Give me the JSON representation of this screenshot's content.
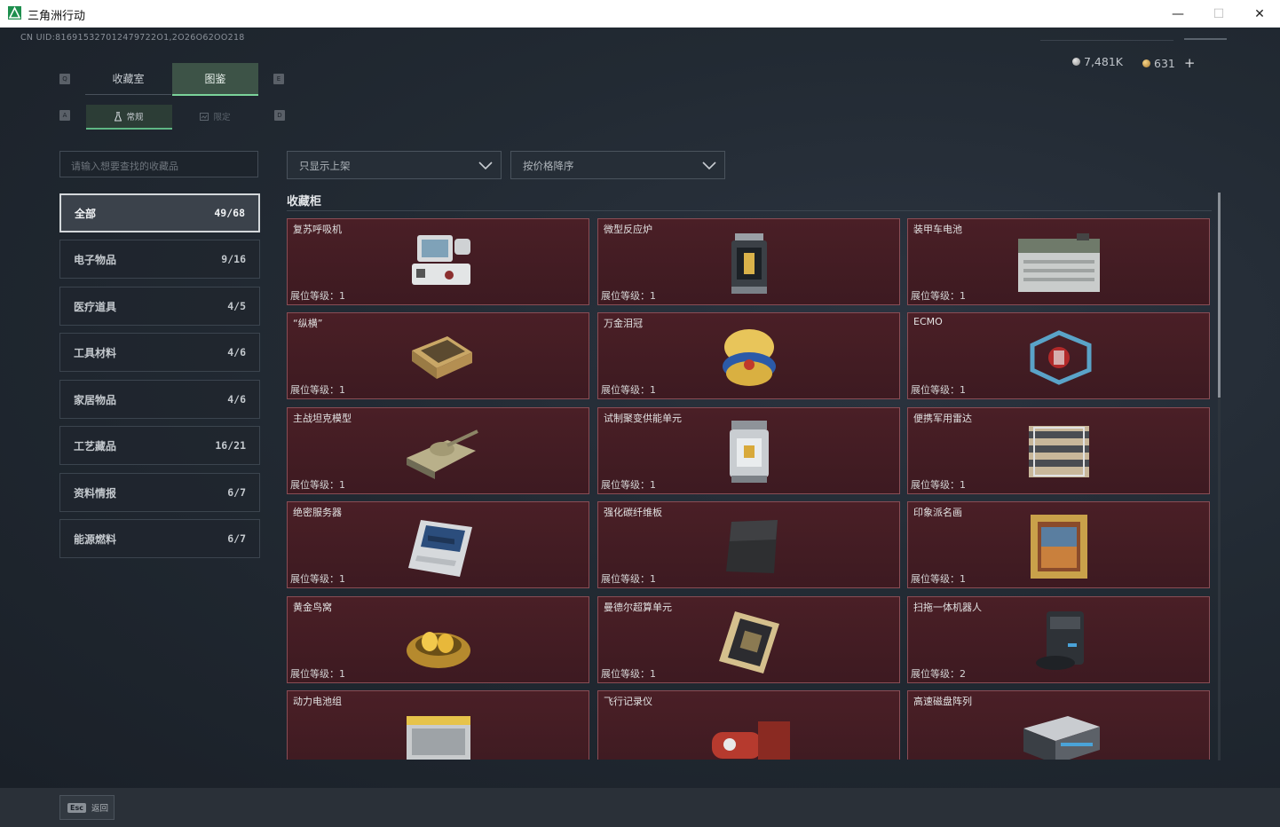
{
  "window": {
    "title": "三角洲行动",
    "minimize": "—",
    "maximize": "☐",
    "close": "✕"
  },
  "header": {
    "uid_text": "CN UID:816915327012479722O1,2O26O62OO218",
    "currency_silver": "7,481K",
    "currency_gold": "631",
    "add_label": "+"
  },
  "key_hints": {
    "q": "Q",
    "e": "E",
    "a": "A",
    "d": "D"
  },
  "tabs": {
    "collection_room": "收藏室",
    "catalog": "图鉴"
  },
  "subtabs": {
    "regular": "常规",
    "limited": "限定"
  },
  "search": {
    "placeholder": "请输入想要查找的收藏品"
  },
  "filters": {
    "shelf_filter": "只显示上架",
    "sort": "按价格降序"
  },
  "categories": [
    {
      "label": "全部",
      "count": "49/68"
    },
    {
      "label": "电子物品",
      "count": "9/16"
    },
    {
      "label": "医疗道具",
      "count": "4/5"
    },
    {
      "label": "工具材料",
      "count": "4/6"
    },
    {
      "label": "家居物品",
      "count": "4/6"
    },
    {
      "label": "工艺藏品",
      "count": "16/21"
    },
    {
      "label": "资料情报",
      "count": "6/7"
    },
    {
      "label": "能源燃料",
      "count": "6/7"
    }
  ],
  "section": {
    "title": "收藏柜"
  },
  "items": [
    {
      "name": "复苏呼吸机",
      "level": "展位等级：1",
      "icon": "ventilator-icon"
    },
    {
      "name": "微型反应炉",
      "level": "展位等级：1",
      "icon": "reactor-icon"
    },
    {
      "name": "装甲车电池",
      "level": "展位等级：1",
      "icon": "battery-icon"
    },
    {
      "name": "“纵横”",
      "level": "展位等级：1",
      "icon": "chessboard-icon"
    },
    {
      "name": "万金泪冠",
      "level": "展位等级：1",
      "icon": "jeweled-egg-icon"
    },
    {
      "name": "ECMO",
      "level": "展位等级：1",
      "icon": "ecmo-icon"
    },
    {
      "name": "主战坦克模型",
      "level": "展位等级：1",
      "icon": "tank-icon"
    },
    {
      "name": "试制聚变供能单元",
      "level": "展位等级：1",
      "icon": "fusion-unit-icon"
    },
    {
      "name": "便携军用雷达",
      "level": "展位等级：1",
      "icon": "radar-icon"
    },
    {
      "name": "绝密服务器",
      "level": "展位等级：1",
      "icon": "server-icon"
    },
    {
      "name": "强化碳纤维板",
      "level": "展位等级：1",
      "icon": "carbon-plate-icon"
    },
    {
      "name": "印象派名画",
      "level": "展位等级：1",
      "icon": "painting-icon"
    },
    {
      "name": "黄金鸟窝",
      "level": "展位等级：1",
      "icon": "golden-nest-icon"
    },
    {
      "name": "曼德尔超算单元",
      "level": "展位等级：1",
      "icon": "computing-unit-icon"
    },
    {
      "name": "扫拖一体机器人",
      "level": "展位等级：2",
      "icon": "robot-vacuum-icon"
    },
    {
      "name": "动力电池组",
      "level": "",
      "icon": "battery-pack-icon"
    },
    {
      "name": "飞行记录仪",
      "level": "",
      "icon": "flight-recorder-icon"
    },
    {
      "name": "高速磁盘阵列",
      "level": "",
      "icon": "disk-array-icon"
    }
  ],
  "footer": {
    "esc_key": "Esc",
    "back_label": "返回"
  }
}
